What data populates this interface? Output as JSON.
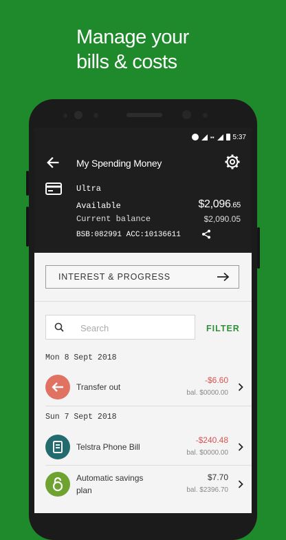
{
  "headline": {
    "line1": "Manage your",
    "line2": "bills & costs"
  },
  "status_bar": {
    "time": "5:37"
  },
  "account": {
    "title": "My Spending Money",
    "type": "Ultra",
    "available_label": "Available",
    "available_whole": "$2,096",
    "available_cents": ".65",
    "current_label": "Current balance",
    "current_value": "$2,090.05",
    "bsb_acc": "BSB:082991 ACC:10136611"
  },
  "interest_button": {
    "label": "INTEREST & PROGRESS"
  },
  "search": {
    "placeholder": "Search",
    "value": ""
  },
  "filter_label": "FILTER",
  "groups": [
    {
      "date": "Mon 8 Sept 2018",
      "transactions": [
        {
          "desc": "Transfer out",
          "amount": "-$6.60",
          "balance": "bal. $0000.00",
          "icon": "arrow-left-icon",
          "icon_color": "#e07262",
          "amount_color": "#d9534f"
        }
      ]
    },
    {
      "date": "Sun 7 Sept 2018",
      "transactions": [
        {
          "desc": "Telstra Phone Bill",
          "amount": "-$240.48",
          "balance": "bal. $0000.00",
          "icon": "bill-icon",
          "icon_color": "#236b6e",
          "amount_color": "#d9534f"
        },
        {
          "desc": "Automatic savings",
          "desc2": "plan",
          "amount": "$7.70",
          "balance": "bal. $2396.70",
          "icon": "lock-icon",
          "icon_color": "#6ea231",
          "amount_color": "#333333"
        }
      ]
    }
  ],
  "colors": {
    "brand_green": "#1f8a2c",
    "header_dark": "#1e1e1e",
    "filter_green": "#2f8f3a"
  }
}
